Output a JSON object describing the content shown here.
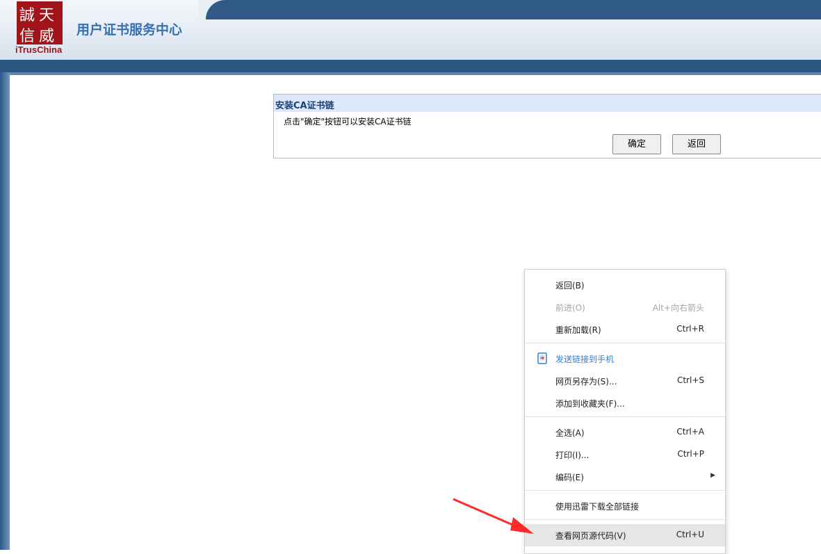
{
  "header": {
    "logo_chars": [
      "誠",
      "天",
      "信",
      "威"
    ],
    "logo_text": "iTrusChina",
    "site_title": "用户证书服务中心"
  },
  "panel": {
    "title": "安装CA证书链",
    "message": "点击\"确定\"按钮可以安装CA证书链",
    "ok_label": "确定",
    "back_label": "返回"
  },
  "context_menu": {
    "items": [
      {
        "label": "返回(B)",
        "shortcut": ""
      },
      {
        "label": "前进(O)",
        "shortcut": "Alt+向右箭头",
        "disabled": true
      },
      {
        "label": "重新加载(R)",
        "shortcut": "Ctrl+R"
      },
      {
        "label": "发送链接到手机",
        "shortcut": "",
        "icon": "phone-send-icon"
      },
      {
        "label": "网页另存为(S)...",
        "shortcut": "Ctrl+S"
      },
      {
        "label": "添加到收藏夹(F)...",
        "shortcut": ""
      },
      {
        "label": "全选(A)",
        "shortcut": "Ctrl+A"
      },
      {
        "label": "打印(I)...",
        "shortcut": "Ctrl+P"
      },
      {
        "label": "编码(E)",
        "shortcut": "",
        "submenu": true
      },
      {
        "label": "使用迅雷下载全部链接",
        "shortcut": ""
      },
      {
        "label": "查看网页源代码(V)",
        "shortcut": "Ctrl+U",
        "highlighted": true
      }
    ]
  },
  "colors": {
    "header_band": "#2f5a86",
    "logo_red": "#a0141a",
    "title_blue": "#3570b0",
    "panel_title_bg": "#dde8fb",
    "annotation_arrow": "#ff2a2a"
  }
}
